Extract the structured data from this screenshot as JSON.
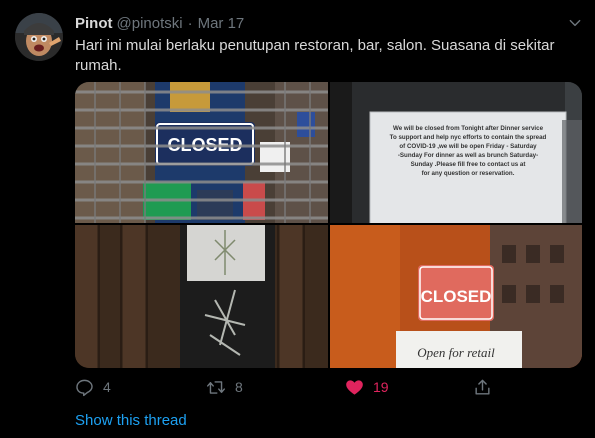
{
  "tweet": {
    "author_name": "Pinot",
    "handle": "@pinotski",
    "separator": "·",
    "date": "Mar 17",
    "text": "Hari ini mulai berlaku penutupan restoran, bar, salon. Suasana di sekitar rumah.",
    "avatar_icon": "avatar-photo"
  },
  "photos": {
    "photo1": {
      "sign_text": "CLOSED",
      "description_icon": "closed-sign-photo"
    },
    "photo2": {
      "notice_lines": [
        "We will be closed from Tonight after Dinner service",
        "To support and help nyc efforts to contain the spread",
        "of COVID-19 ,we will be open Friday - Saturday",
        "-Sunday For dinner as well as brunch Saturday-",
        "Sunday .Please fill free to contact us at",
        "for any question or reservation."
      ]
    },
    "photo3": {
      "description_icon": "window-plant-photo"
    },
    "photo4": {
      "sign_text": "CLOSED",
      "note_text": "Open for retail"
    }
  },
  "actions": {
    "reply_count": "4",
    "retweet_count": "8",
    "like_count": "19",
    "reply_icon": "reply-icon",
    "retweet_icon": "retweet-icon",
    "like_icon": "heart-icon",
    "share_icon": "share-icon"
  },
  "thread_link": "Show this thread",
  "colors": {
    "background": "#000000",
    "text": "#d9d9d9",
    "muted": "#6e767d",
    "like": "#e0245e",
    "link": "#1da1f2"
  }
}
